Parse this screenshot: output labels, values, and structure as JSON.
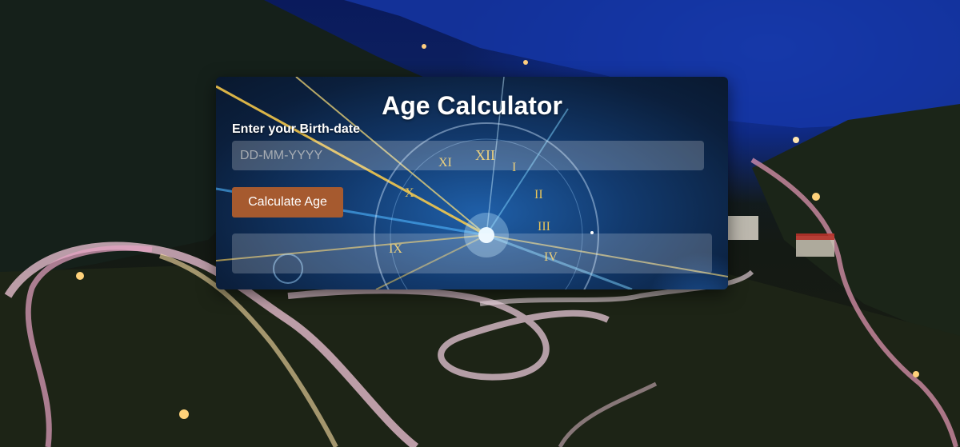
{
  "app": {
    "title": "Age Calculator"
  },
  "form": {
    "label": "Enter your Birth-date",
    "date_placeholder": "DD-MM-YYYY",
    "date_value": "",
    "button_label": "Calculate Age",
    "result_text": ""
  },
  "colors": {
    "button": "#a65a2f",
    "title_text": "#ffffff"
  }
}
